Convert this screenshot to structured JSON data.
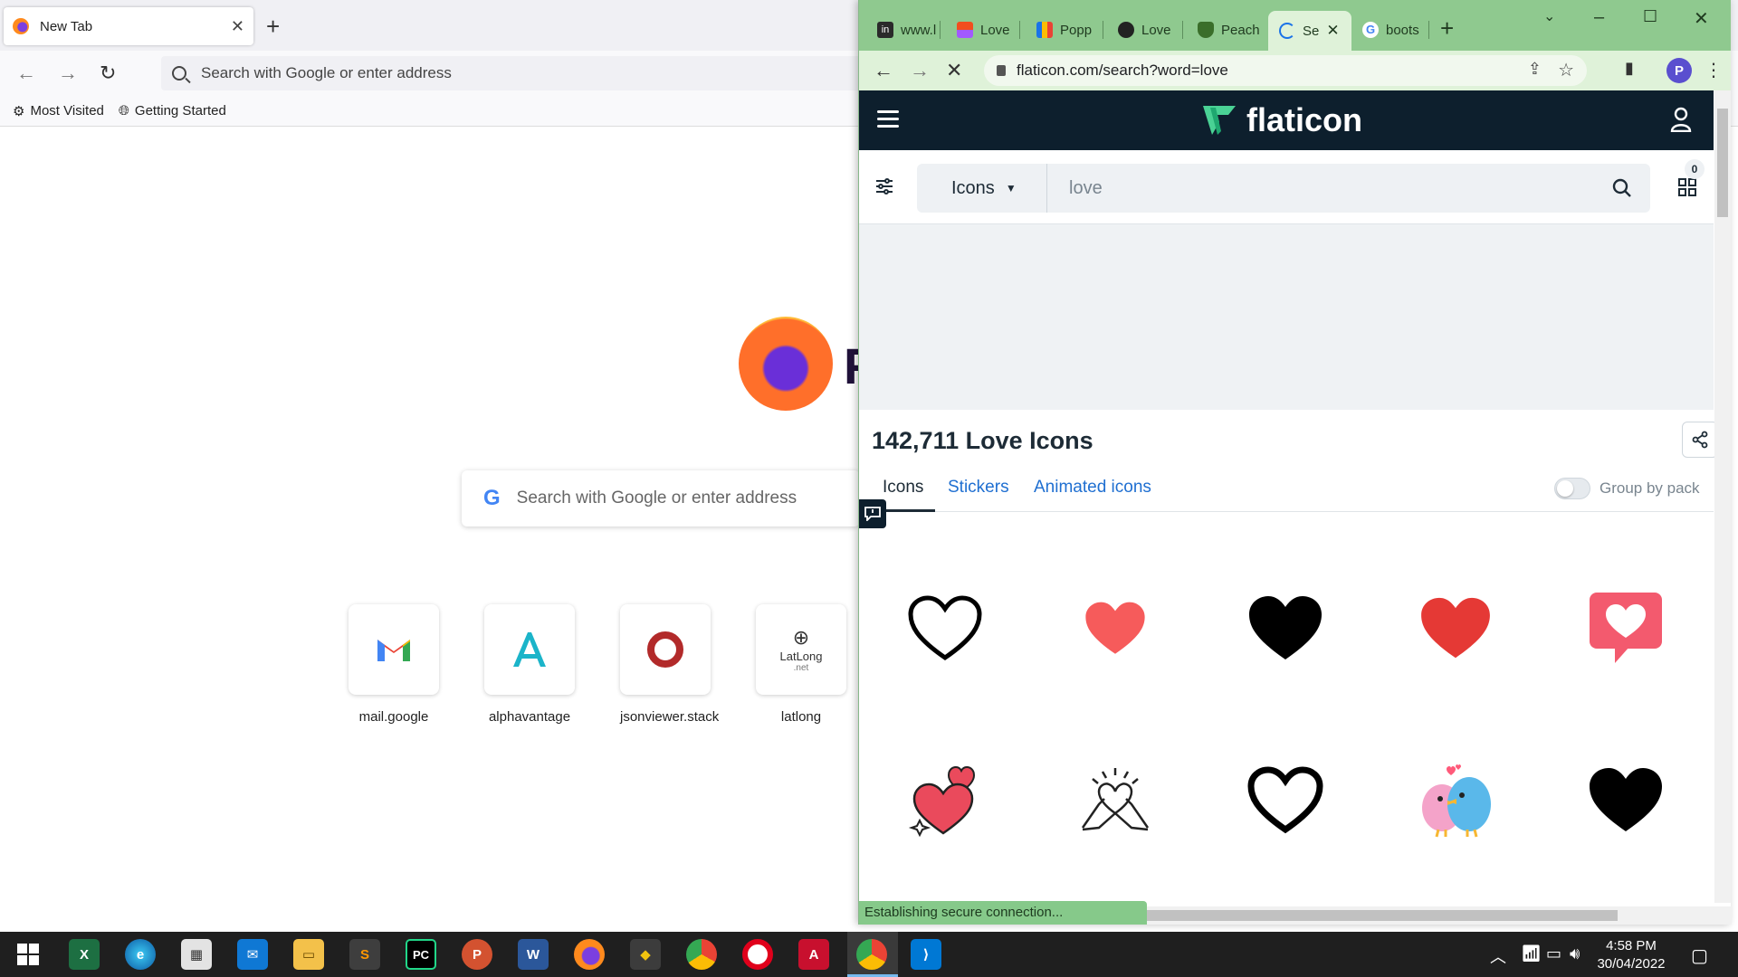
{
  "firefox": {
    "tab_title": "New Tab",
    "urlbar_placeholder": "Search with Google or enter address",
    "bookmarks": [
      "Most Visited",
      "Getting Started"
    ],
    "logo_letter": "F",
    "search_placeholder": "Search with Google or enter address",
    "top_sites": [
      {
        "label": "mail.google",
        "icon": "gmail-icon"
      },
      {
        "label": "alphavantage",
        "icon": "alphavantage-icon"
      },
      {
        "label": "jsonviewer.stack",
        "icon": "jsonviewer-icon"
      },
      {
        "label": "latlong",
        "icon": "latlong-icon",
        "tile_text": "LatLong",
        "tile_sub": ".net"
      }
    ]
  },
  "chrome": {
    "tabs": [
      {
        "label": "www.l",
        "icon": "linkedin-icon"
      },
      {
        "label": "Love",
        "icon": "figma-icon"
      },
      {
        "label": "Popp",
        "icon": "poppins-icon"
      },
      {
        "label": "Love",
        "icon": "globe-icon"
      },
      {
        "label": "Peach",
        "icon": "peach-icon"
      }
    ],
    "active_tab": {
      "label": "Se",
      "icon": "loading-spinner-icon"
    },
    "after_tabs": [
      {
        "label": "boots",
        "icon": "google-icon"
      }
    ],
    "url": "flaticon.com/search?word=love",
    "profile_initial": "P",
    "status_text": "Establishing secure connection..."
  },
  "flaticon": {
    "brand": "flaticon",
    "search_type": "Icons",
    "query": "love",
    "collections_count": "0",
    "results_title": "142,711 Love Icons",
    "tabs": [
      "Icons",
      "Stickers",
      "Animated icons"
    ],
    "group_by_pack": "Group by pack",
    "accent_color": "#1f6fd1",
    "header_color": "#0d1f2d",
    "results": [
      "heart-outline-icon",
      "heart-red-flat-icon",
      "heart-black-icon",
      "heart-red-icon",
      "heart-chat-bubble-icon",
      "hearts-sparkle-icon",
      "hands-heart-icon",
      "heart-outline-thick-icon",
      "love-birds-icon",
      "heart-black-filled-icon"
    ]
  },
  "taskbar": {
    "time": "4:58 PM",
    "date": "30/04/2022",
    "apps": [
      "windows-start",
      "excel",
      "edge",
      "store",
      "mail",
      "file-explorer",
      "sublime-text",
      "pycharm",
      "powerpoint",
      "word",
      "firefox",
      "git",
      "chrome",
      "opera",
      "acrobat",
      "chrome-profile",
      "vscode"
    ]
  }
}
